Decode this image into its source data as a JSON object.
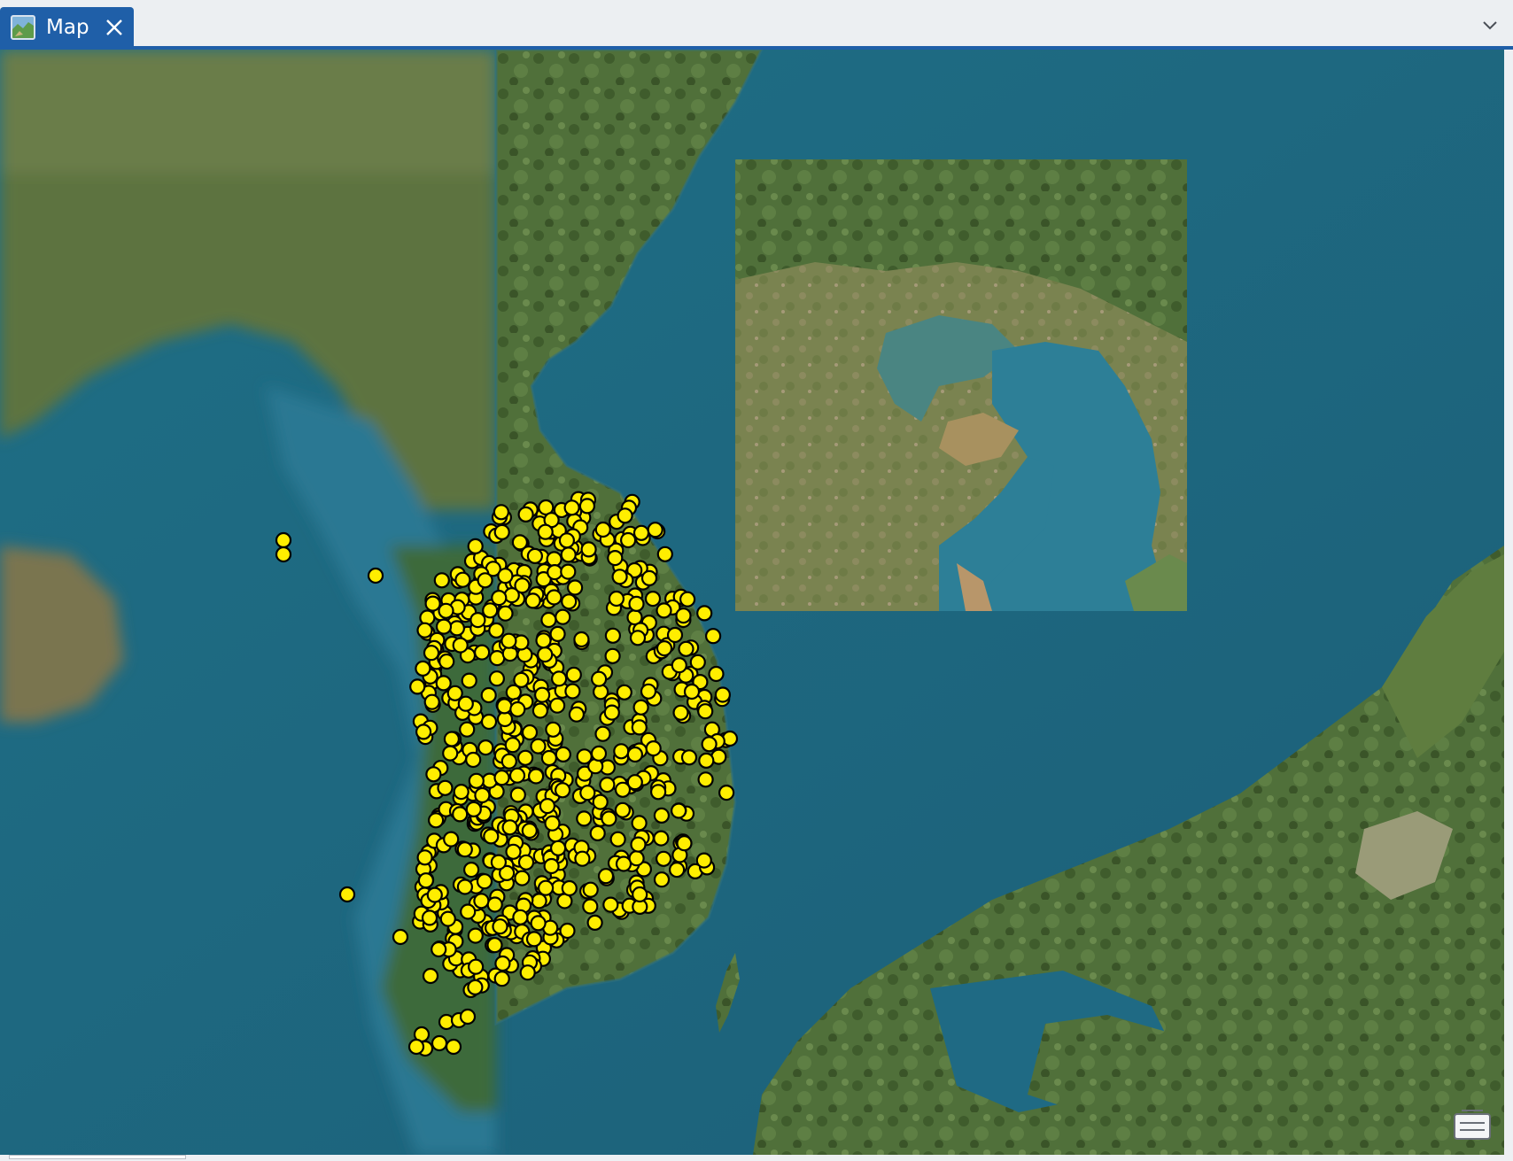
{
  "tab": {
    "label": "Map",
    "icon": "map-icon",
    "close_icon": "close-icon"
  },
  "tab_menu_icon": "chevron-down-icon",
  "map": {
    "basemap": "satellite-imagery",
    "point_color": "#ffee00",
    "point_outline": "#000000",
    "basemap_toggle_icon": "basemap-gallery-icon",
    "colors": {
      "accent": "#1f5fa8",
      "sea": "#1d6c84",
      "land": "#4f6d37"
    }
  }
}
